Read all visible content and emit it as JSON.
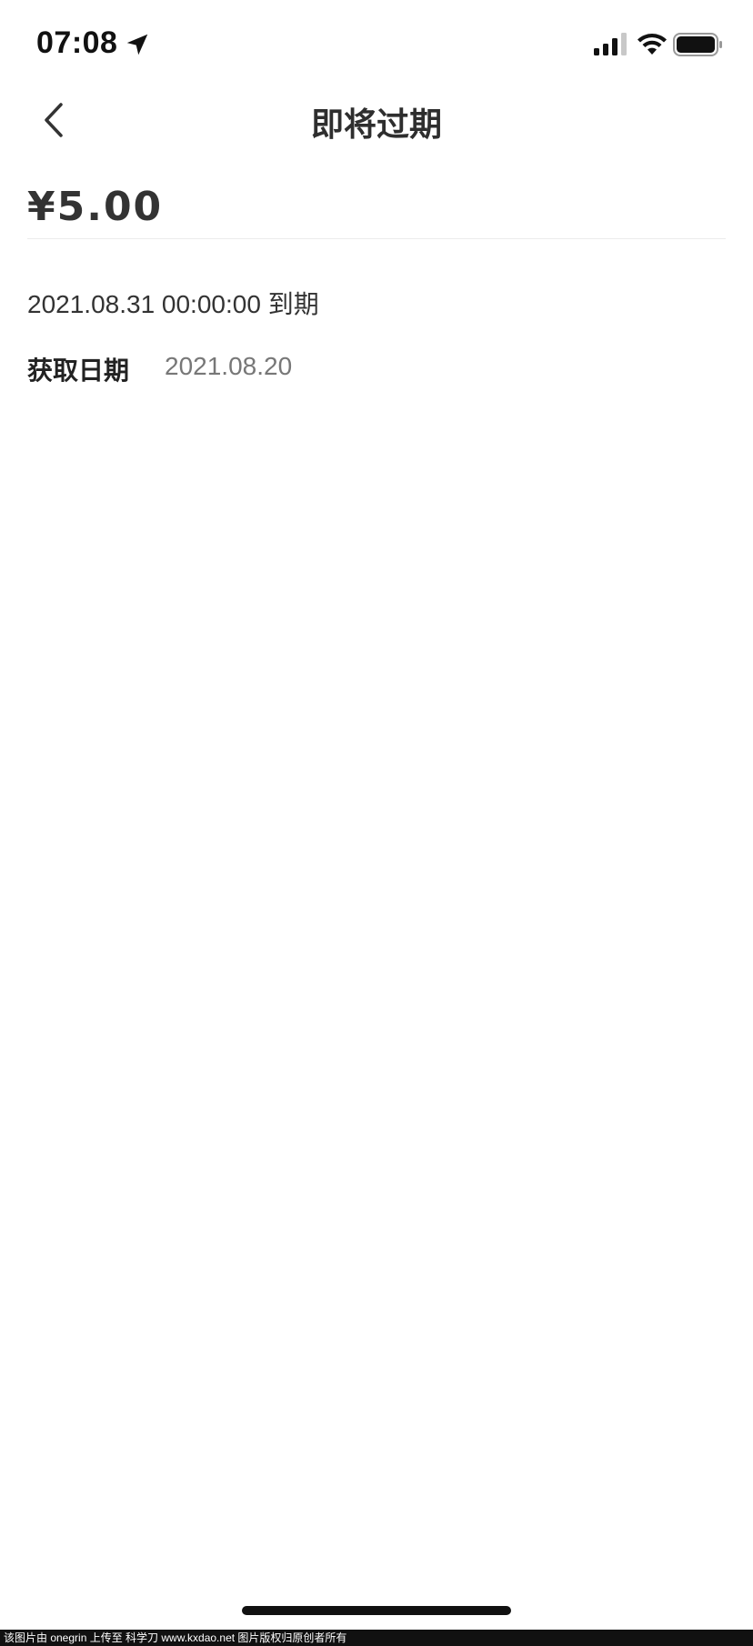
{
  "status_bar": {
    "time": "07:08",
    "icons": [
      "location-arrow-icon",
      "cellular-signal-icon",
      "wifi-icon",
      "battery-icon"
    ]
  },
  "nav": {
    "back_icon": "chevron-left-icon",
    "title": "即将过期"
  },
  "coupon": {
    "amount": "¥5.00",
    "expire_text": "2021.08.31 00:00:00 到期",
    "obtain_label": "获取日期",
    "obtain_date": "2021.08.20"
  },
  "watermark": {
    "text": "该图片由 onegrin 上传至 科学刀 www.kxdao.net 图片版权归原创者所有"
  },
  "colors": {
    "text_primary": "#333333",
    "text_secondary": "#777777",
    "divider": "#ececec",
    "background": "#ffffff"
  }
}
